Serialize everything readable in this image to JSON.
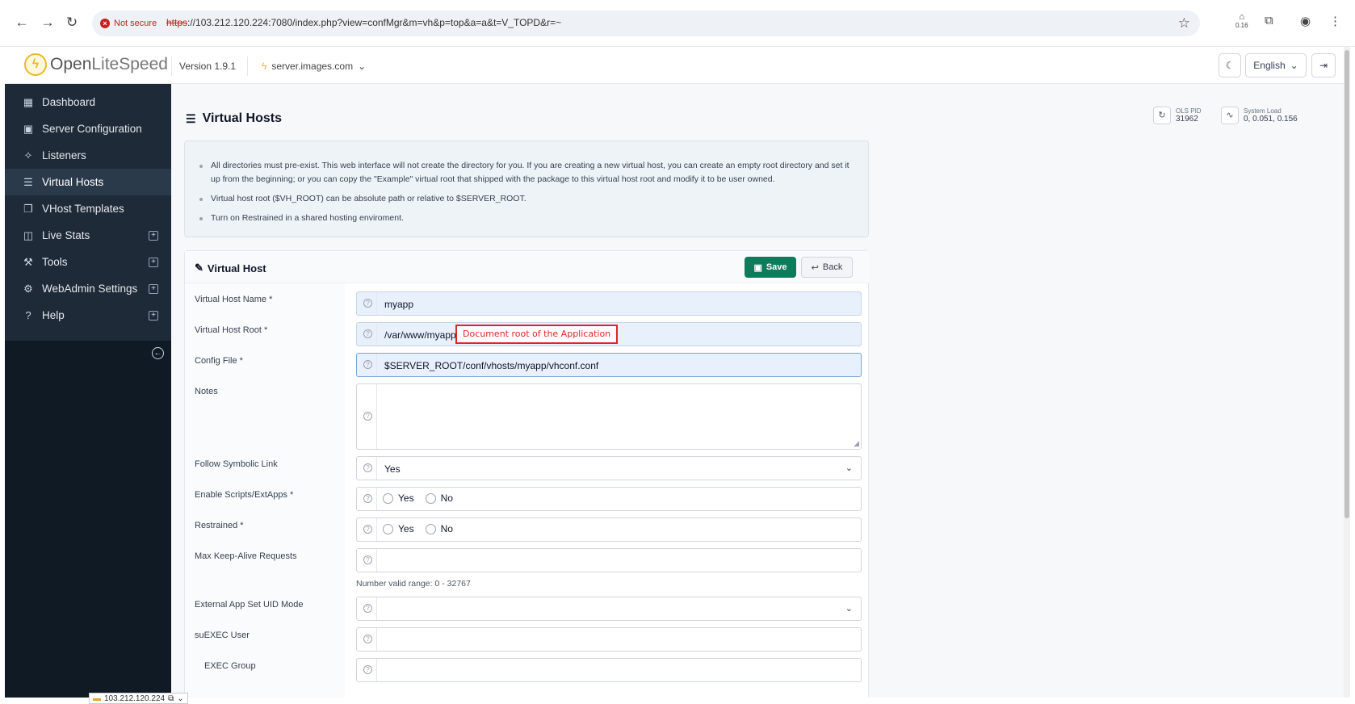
{
  "browser": {
    "not_secure": "Not secure",
    "url_scheme": "https",
    "url_rest": "://103.212.120.224:7080/index.php?view=confMgr&m=vh&p=top&a=a&t=V_TOPD&r=~",
    "ext_badge": "0.16"
  },
  "header": {
    "logo_open": "Open",
    "logo_lite": "LiteSpeed",
    "version": "Version 1.9.1",
    "server": "server.images.com",
    "language": "English"
  },
  "sidebar": {
    "items": [
      {
        "label": "Dashboard",
        "icon": "dashboard-icon"
      },
      {
        "label": "Server Configuration",
        "icon": "server-icon"
      },
      {
        "label": "Listeners",
        "icon": "listeners-icon"
      },
      {
        "label": "Virtual Hosts",
        "icon": "vhosts-icon"
      },
      {
        "label": "VHost Templates",
        "icon": "templates-icon"
      },
      {
        "label": "Live Stats",
        "icon": "stats-icon"
      },
      {
        "label": "Tools",
        "icon": "wrench-icon"
      },
      {
        "label": "WebAdmin Settings",
        "icon": "gear-icon"
      },
      {
        "label": "Help",
        "icon": "help-icon"
      }
    ]
  },
  "page": {
    "title": "Virtual Hosts",
    "ols_pid_label": "OLS PID",
    "ols_pid": "31962",
    "load_label": "System Load",
    "load": "0, 0.051, 0.156"
  },
  "info": {
    "line1": "All directories must pre-exist. This web interface will not create the directory for you. If you are creating a new virtual host, you can create an empty root directory and set it up from the beginning; or you can copy the \"Example\" virtual root that shipped with the package to this virtual host root and modify it to be user owned.",
    "line2": "Virtual host root ($VH_ROOT) can be absolute path or relative to $SERVER_ROOT.",
    "line3": "Turn on Restrained in a shared hosting enviroment."
  },
  "card": {
    "title": "Virtual Host",
    "save": "Save",
    "back": "Back"
  },
  "fields": {
    "name_label": "Virtual Host Name *",
    "name_value": "myapp",
    "root_label": "Virtual Host Root *",
    "root_value": "/var/www/myapp",
    "root_annotation": "Document root of the Application",
    "config_label": "Config File *",
    "config_value": "$SERVER_ROOT/conf/vhosts/myapp/vhconf.conf",
    "notes_label": "Notes",
    "symlink_label": "Follow Symbolic Link",
    "symlink_value": "Yes",
    "scripts_label": "Enable Scripts/ExtApps *",
    "restrained_label": "Restrained *",
    "yes": "Yes",
    "no": "No",
    "keepalive_label": "Max Keep-Alive Requests",
    "keepalive_note": "Number valid range: 0 - 32767",
    "uid_label": "External App Set UID Mode",
    "suexec_user_label": "suEXEC User",
    "suexec_group_label": "EXEC Group"
  },
  "status": {
    "url": "103.212.120.224"
  }
}
